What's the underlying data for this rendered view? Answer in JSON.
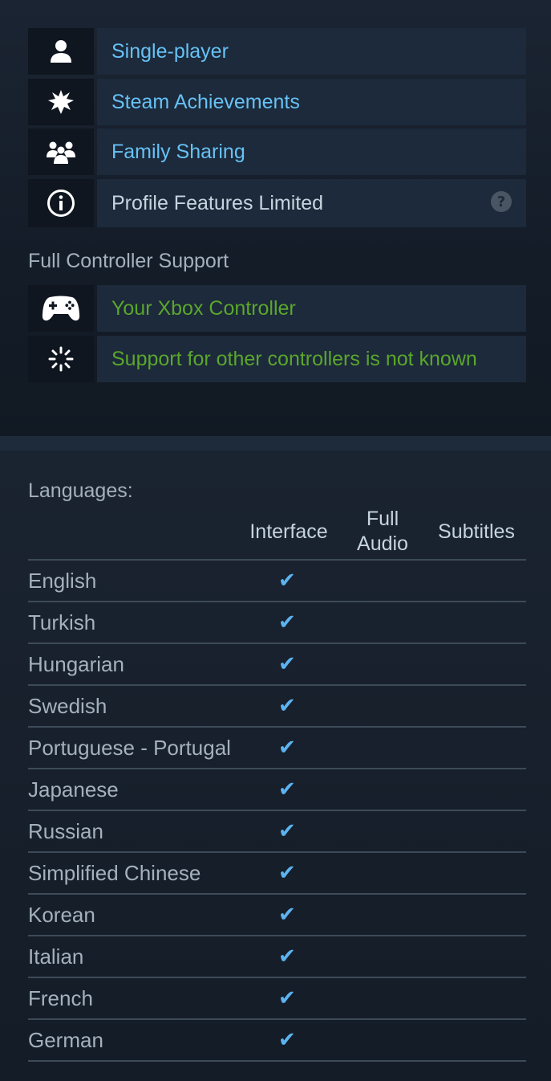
{
  "features": [
    {
      "label": "Single-player",
      "icon": "person-icon",
      "style": "link"
    },
    {
      "label": "Steam Achievements",
      "icon": "achievement-icon",
      "style": "link"
    },
    {
      "label": "Family Sharing",
      "icon": "family-icon",
      "style": "link"
    },
    {
      "label": "Profile Features Limited",
      "icon": "info-icon",
      "style": "plain",
      "help": "?"
    }
  ],
  "controller": {
    "title": "Full Controller Support",
    "items": [
      {
        "label": "Your Xbox Controller",
        "icon": "gamepad-icon"
      },
      {
        "label": "Support for other controllers is not known",
        "icon": "loading-icon"
      }
    ]
  },
  "languages": {
    "title": "Languages:",
    "columns": {
      "interface": "Interface",
      "full_audio_1": "Full",
      "full_audio_2": "Audio",
      "subtitles": "Subtitles"
    },
    "check_glyph": "✔",
    "rows": [
      {
        "name": "English",
        "interface": true,
        "full_audio": false,
        "subtitles": false
      },
      {
        "name": "Turkish",
        "interface": true,
        "full_audio": false,
        "subtitles": false
      },
      {
        "name": "Hungarian",
        "interface": true,
        "full_audio": false,
        "subtitles": false
      },
      {
        "name": "Swedish",
        "interface": true,
        "full_audio": false,
        "subtitles": false
      },
      {
        "name": "Portuguese - Portugal",
        "interface": true,
        "full_audio": false,
        "subtitles": false
      },
      {
        "name": "Japanese",
        "interface": true,
        "full_audio": false,
        "subtitles": false
      },
      {
        "name": "Russian",
        "interface": true,
        "full_audio": false,
        "subtitles": false
      },
      {
        "name": "Simplified Chinese",
        "interface": true,
        "full_audio": false,
        "subtitles": false
      },
      {
        "name": "Korean",
        "interface": true,
        "full_audio": false,
        "subtitles": false
      },
      {
        "name": "Italian",
        "interface": true,
        "full_audio": false,
        "subtitles": false
      },
      {
        "name": "French",
        "interface": true,
        "full_audio": false,
        "subtitles": false
      },
      {
        "name": "German",
        "interface": true,
        "full_audio": false,
        "subtitles": false
      }
    ]
  },
  "colors": {
    "link": "#67c1f5",
    "green": "#5ba62c",
    "check": "#5cb3f0",
    "background": "#121a25"
  }
}
